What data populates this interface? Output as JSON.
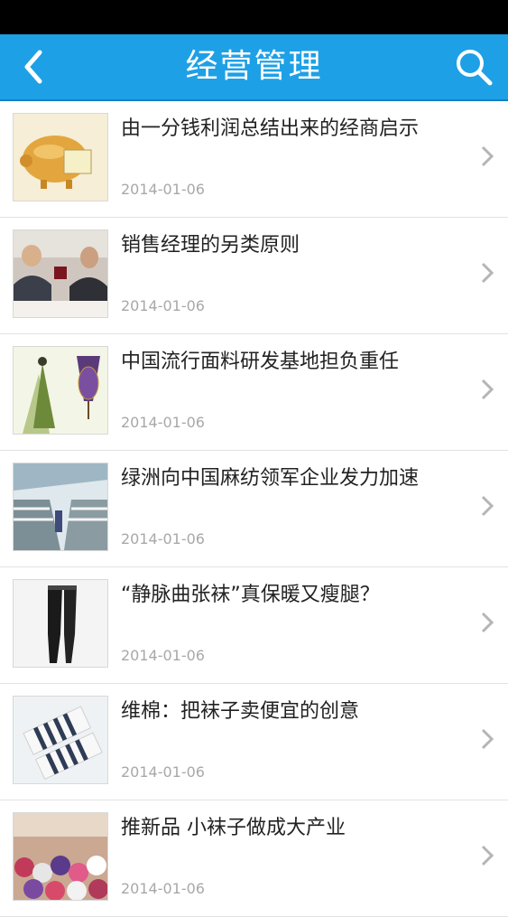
{
  "header": {
    "title": "经营管理"
  },
  "icons": {
    "back": "chevron-left-icon",
    "search": "search-icon",
    "row_arrow": "chevron-right-icon"
  },
  "colors": {
    "header_bg": "#1ea0e6",
    "date": "#a8a8a8"
  },
  "articles": [
    {
      "title": "由一分钱利润总结出来的经商启示",
      "date": "2014-01-06",
      "thumb": "piggy-bank"
    },
    {
      "title": "销售经理的另类原则",
      "date": "2014-01-06",
      "thumb": "business-toast"
    },
    {
      "title": "中国流行面料研发基地担负重任",
      "date": "2014-01-06",
      "thumb": "fashion-fabric"
    },
    {
      "title": "绿洲向中国麻纺领军企业发力加速",
      "date": "2014-01-06",
      "thumb": "textile-factory"
    },
    {
      "title": "“静脉曲张袜”真保暖又瘦腿？",
      "date": "2014-01-06",
      "thumb": "compression-socks"
    },
    {
      "title": "维棉：把袜子卖便宜的创意",
      "date": "2014-01-06",
      "thumb": "striped-socks"
    },
    {
      "title": "推新品 小袜子做成大产业",
      "date": "2014-01-06",
      "thumb": "sock-shop"
    }
  ]
}
